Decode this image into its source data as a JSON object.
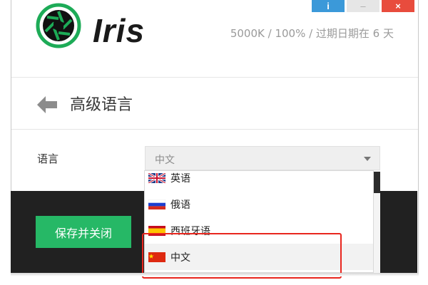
{
  "app": {
    "logo_text": "Iris",
    "status": "5000K / 100% / 过期日期在 6 天"
  },
  "window_buttons": {
    "info": "i",
    "minimize": "–",
    "close": "×"
  },
  "page": {
    "title": "高级语言"
  },
  "language": {
    "label": "语言",
    "selected": "中文",
    "options": [
      {
        "label": "英语",
        "flag": "uk-flag-icon"
      },
      {
        "label": "俄语",
        "flag": "russia-flag-icon"
      },
      {
        "label": "西班牙语",
        "flag": "spain-flag-icon"
      },
      {
        "label": "中文",
        "flag": "china-flag-icon"
      }
    ]
  },
  "actions": {
    "save_close": "保存并关闭"
  },
  "colors": {
    "accent_green": "#26b866",
    "info_blue": "#3b99d9",
    "close_red": "#e84c3d",
    "footer_dark": "#212121",
    "highlight_red": "#e8261e"
  }
}
